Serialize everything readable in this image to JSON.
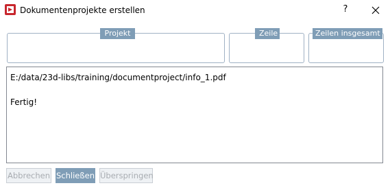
{
  "window": {
    "title": "Dokumentenprojekte erstellen",
    "help_label": "?"
  },
  "groups": {
    "project": {
      "title": "Projekt",
      "value": ""
    },
    "line": {
      "title": "Zeile",
      "value": ""
    },
    "total_lines": {
      "title": "Zeilen insgesamt",
      "value": ""
    }
  },
  "log": {
    "text": "E:/data/23d-libs/training/documentproject/info_1.pdf\n\nFertig!"
  },
  "buttons": {
    "cancel": "Abbrechen",
    "close": "Schließen",
    "skip": "Überspringen"
  },
  "colors": {
    "accent": "#7f9db6",
    "app_icon": "#c8262d",
    "group_border": "#9fb1c4"
  }
}
